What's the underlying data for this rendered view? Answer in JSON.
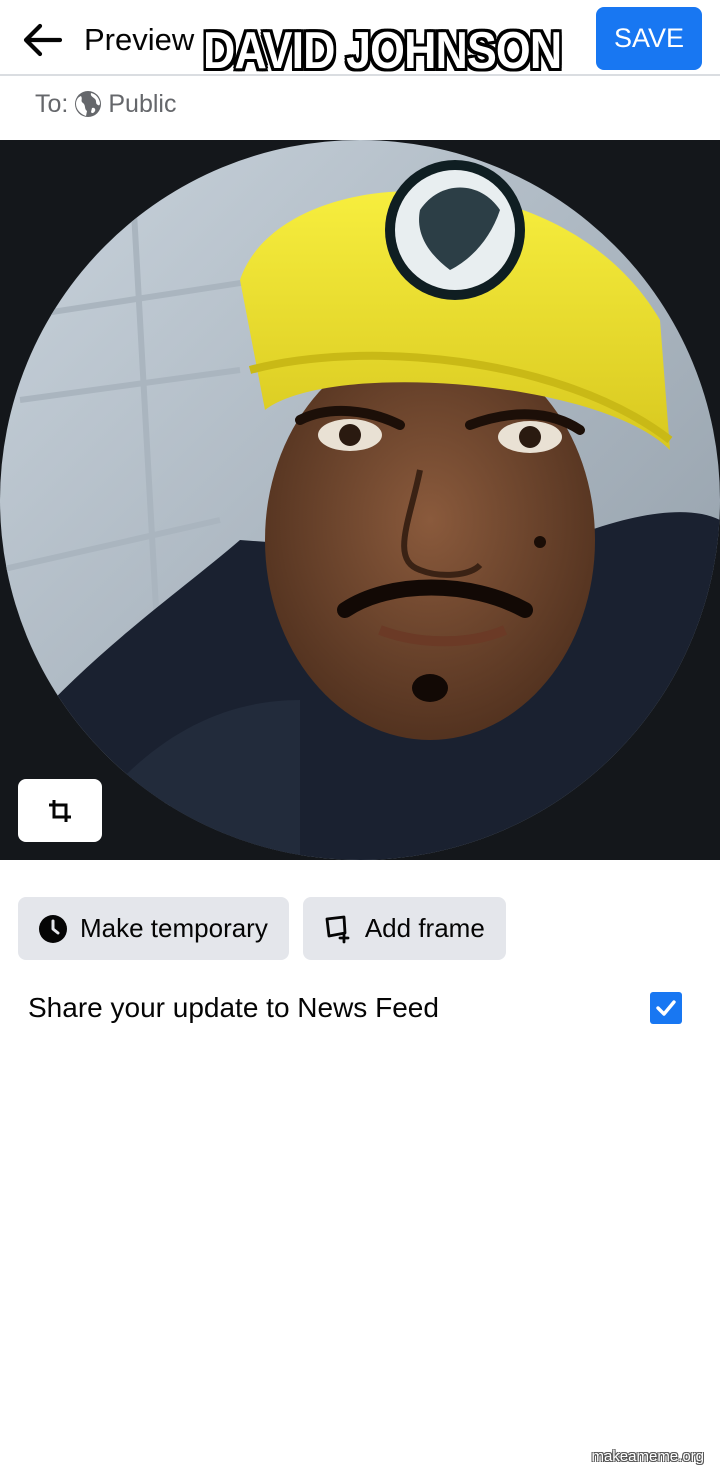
{
  "header": {
    "back_icon": "arrow-left-icon",
    "title": "Preview",
    "save_label": "SAVE",
    "accent": "#1877f2"
  },
  "meme": {
    "caption": "DAVID JOHNSON",
    "watermark": "makeameme.org"
  },
  "audience": {
    "prefix": "To:",
    "icon": "globe-icon",
    "value": "Public"
  },
  "photo": {
    "subject": "Profile picture preview, circular crop",
    "crop_icon": "crop-icon"
  },
  "actions": {
    "temporary_label": "Make temporary",
    "temporary_icon": "clock-icon",
    "frame_label": "Add frame",
    "frame_icon": "frame-icon"
  },
  "share": {
    "label": "Share your update to News Feed",
    "checked": true
  }
}
